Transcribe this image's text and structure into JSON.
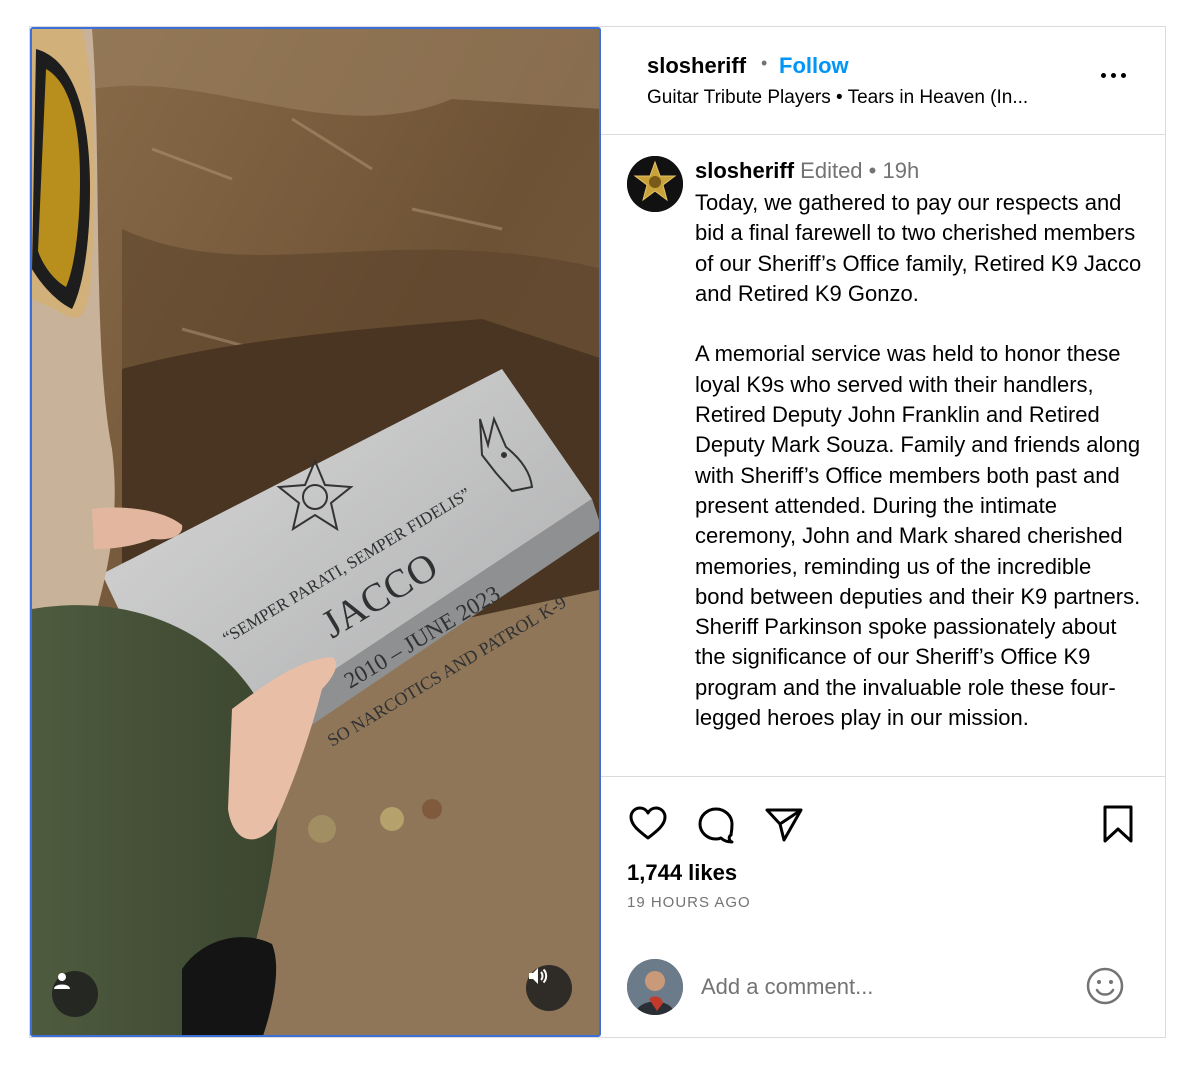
{
  "header": {
    "username": "slosheriff",
    "separator": "•",
    "follow_label": "Follow",
    "audio": "Guitar Tribute Players • Tears in Heaven (In..."
  },
  "caption": {
    "username": "slosheriff",
    "edited": "Edited",
    "separator": " • ",
    "time": "19h",
    "text": "Today, we gathered to pay our respects and bid a final farewell to two cherished members of our Sheriff’s Office family, Retired K9 Jacco and Retired K9 Gonzo.\n\nA memorial service was held to honor these loyal K9s who served with their handlers, Retired Deputy John Franklin and Retired Deputy Mark Souza. Family and friends along with Sheriff’s Office members both past and present attended. During the intimate ceremony, John and Mark shared cherished memories, reminding us of the incredible bond between deputies and their K9 partners. Sheriff Parkinson spoke passionately about the significance of our Sheriff’s Office K9 program and the invaluable role these four-legged heroes play in our mission."
  },
  "media": {
    "stone_inscription": "“SEMPER PARATI, SEMPER FIDELIS”",
    "stone_name": "JACCO",
    "stone_dates": "2010 – JUNE 2023",
    "stone_subtitle": "SO NARCOTICS AND PATROL K-9"
  },
  "engagement": {
    "likes": "1,744 likes",
    "posted": "19 HOURS AGO"
  },
  "comment": {
    "placeholder": "Add a comment..."
  },
  "icons": [
    "like-icon",
    "comment-icon",
    "share-icon",
    "save-icon",
    "more-icon",
    "user-tag-icon",
    "sound-icon",
    "emoji-icon"
  ],
  "colors": {
    "follow": "#0095f6",
    "muted": "#737373",
    "border": "#dbdbdb"
  }
}
